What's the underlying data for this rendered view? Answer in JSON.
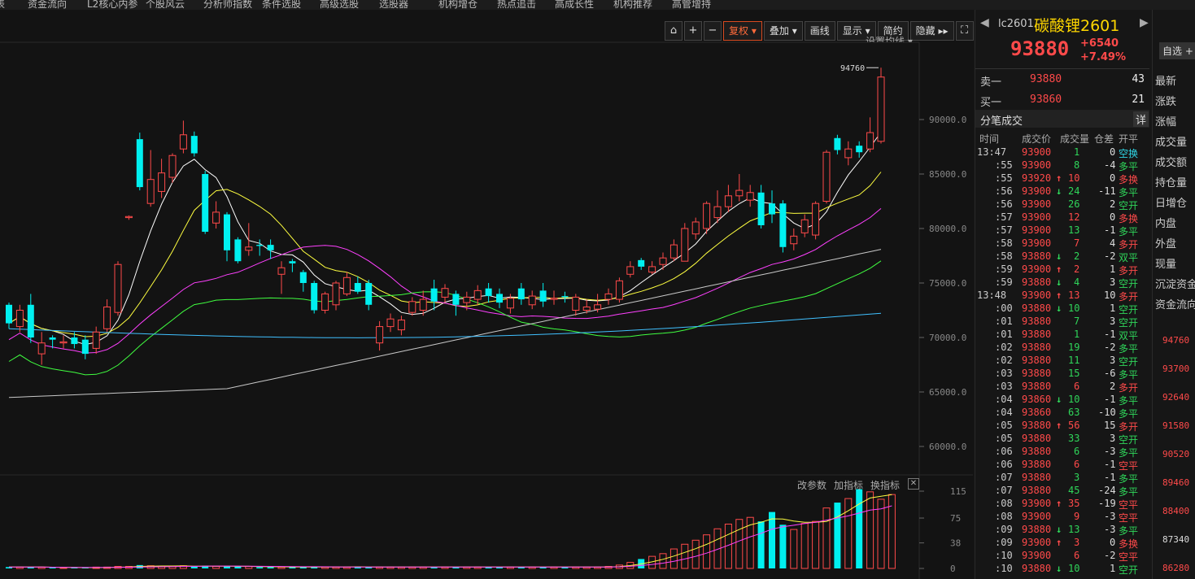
{
  "topnav": [
    "表",
    "资金流向",
    "L2核心内参",
    "个股风云",
    "分析师指数",
    "条件选股",
    "高级选股",
    "选股器",
    "机构增仓",
    "热点追击",
    "高成长性",
    "机构推荐",
    "高管增持"
  ],
  "toolbar": {
    "fuquan": "复权",
    "diejia": "叠加",
    "huaxian": "画线",
    "xianshi": "显示",
    "jianyue": "简约",
    "yincang": "隐藏"
  },
  "settings_ma": "设置均线",
  "max_label": "94760",
  "price_axis": [
    "90000.0",
    "85000.0",
    "80000.0",
    "75000.0",
    "70000.0",
    "65000.0",
    "60000.0"
  ],
  "vol_links": [
    "改参数",
    "加指标",
    "换指标"
  ],
  "vol_axis": [
    "115",
    "75",
    "38",
    "0"
  ],
  "quote": {
    "code": "lc2601",
    "name": "碳酸锂2601",
    "price": "93880",
    "change": "+6540",
    "pct": "+7.49%",
    "fav": "自选"
  },
  "orderbook": [
    {
      "label": "卖一",
      "price": "93880",
      "qty": "43"
    },
    {
      "label": "买一",
      "price": "93860",
      "qty": "21"
    }
  ],
  "ticks_title": "分笔成交",
  "ticks_detail": "详",
  "ticks_header": [
    "时间",
    "成交价",
    "成交量",
    "仓差",
    "开平"
  ],
  "ticks": [
    [
      "13:47",
      "93900",
      "",
      "1",
      "0",
      "空换",
      "red",
      "green",
      "cyan"
    ],
    [
      ":55",
      "93900",
      "",
      "8",
      "-4",
      "多平",
      "red",
      "green",
      "green"
    ],
    [
      ":55",
      "93920",
      "↑",
      "10",
      "0",
      "多换",
      "red",
      "red",
      "red"
    ],
    [
      ":56",
      "93900",
      "↓",
      "24",
      "-11",
      "多平",
      "red",
      "green",
      "green"
    ],
    [
      ":56",
      "93900",
      "",
      "26",
      "2",
      "空开",
      "red",
      "green",
      "green"
    ],
    [
      ":57",
      "93900",
      "",
      "12",
      "0",
      "多换",
      "red",
      "red",
      "red"
    ],
    [
      ":57",
      "93900",
      "",
      "13",
      "-1",
      "多平",
      "red",
      "green",
      "green"
    ],
    [
      ":58",
      "93900",
      "",
      "7",
      "4",
      "多开",
      "red",
      "red",
      "red"
    ],
    [
      ":58",
      "93880",
      "↓",
      "2",
      "-2",
      "双平",
      "red",
      "green",
      "green"
    ],
    [
      ":59",
      "93900",
      "↑",
      "2",
      "1",
      "多开",
      "red",
      "red",
      "red"
    ],
    [
      ":59",
      "93880",
      "↓",
      "4",
      "3",
      "空开",
      "red",
      "green",
      "green"
    ],
    [
      "13:48",
      "93900",
      "↑",
      "13",
      "10",
      "多开",
      "red",
      "red",
      "red"
    ],
    [
      ":00",
      "93880",
      "↓",
      "10",
      "1",
      "空开",
      "red",
      "green",
      "green"
    ],
    [
      ":01",
      "93880",
      "",
      "7",
      "3",
      "空开",
      "red",
      "green",
      "green"
    ],
    [
      ":01",
      "93880",
      "",
      "1",
      "-1",
      "双平",
      "red",
      "green",
      "green"
    ],
    [
      ":02",
      "93880",
      "",
      "19",
      "-2",
      "多平",
      "red",
      "green",
      "green"
    ],
    [
      ":02",
      "93880",
      "",
      "11",
      "3",
      "空开",
      "red",
      "green",
      "green"
    ],
    [
      ":03",
      "93880",
      "",
      "15",
      "-6",
      "多平",
      "red",
      "green",
      "green"
    ],
    [
      ":03",
      "93880",
      "",
      "6",
      "2",
      "多开",
      "red",
      "red",
      "red"
    ],
    [
      ":04",
      "93860",
      "↓",
      "10",
      "-1",
      "多平",
      "red",
      "green",
      "green"
    ],
    [
      ":04",
      "93860",
      "",
      "63",
      "-10",
      "多平",
      "red",
      "green",
      "green"
    ],
    [
      ":05",
      "93880",
      "↑",
      "56",
      "15",
      "多开",
      "red",
      "red",
      "red"
    ],
    [
      ":05",
      "93880",
      "",
      "33",
      "3",
      "空开",
      "red",
      "green",
      "green"
    ],
    [
      ":06",
      "93880",
      "",
      "6",
      "-3",
      "多平",
      "red",
      "green",
      "green"
    ],
    [
      ":06",
      "93880",
      "",
      "6",
      "-1",
      "空平",
      "red",
      "red",
      "red"
    ],
    [
      ":07",
      "93880",
      "",
      "3",
      "-1",
      "多平",
      "red",
      "green",
      "green"
    ],
    [
      ":07",
      "93880",
      "",
      "45",
      "-24",
      "多平",
      "red",
      "green",
      "green"
    ],
    [
      ":08",
      "93900",
      "↑",
      "35",
      "-19",
      "空平",
      "red",
      "red",
      "red"
    ],
    [
      ":08",
      "93900",
      "",
      "9",
      "-3",
      "空平",
      "red",
      "red",
      "red"
    ],
    [
      ":09",
      "93880",
      "↓",
      "13",
      "-3",
      "多平",
      "red",
      "green",
      "green"
    ],
    [
      ":09",
      "93900",
      "↑",
      "3",
      "0",
      "多换",
      "red",
      "red",
      "red"
    ],
    [
      ":10",
      "93900",
      "",
      "6",
      "-2",
      "空平",
      "red",
      "red",
      "red"
    ],
    [
      ":10",
      "93880",
      "↓",
      "10",
      "1",
      "空开",
      "red",
      "green",
      "green"
    ]
  ],
  "right_labels": [
    "最新",
    "涨跌",
    "涨幅",
    "成交量",
    "成交额",
    "持仓量",
    "日增仓",
    "内盘",
    "外盘",
    "现量",
    "沉淀资金",
    "资金流向"
  ],
  "right_prices": [
    "94760",
    "93700",
    "92640",
    "91580",
    "90520",
    "89460",
    "88400",
    "87340",
    "86280"
  ],
  "colors": {
    "up": "#ff4a4a",
    "down": "#00f0f0",
    "ma5": "#ffffff",
    "ma10": "#ffff40",
    "ma20": "#ff40ff",
    "ma30": "#40ff40",
    "ma60": "#c8c8c8",
    "ma120": "#40c0ff"
  },
  "candles": [
    {
      "o": 73000,
      "c": 71300,
      "h": 73200,
      "l": 70800
    },
    {
      "o": 71000,
      "c": 72500,
      "h": 73000,
      "l": 70500
    },
    {
      "o": 73000,
      "c": 70000,
      "h": 74000,
      "l": 69500
    },
    {
      "o": 68500,
      "c": 69500,
      "h": 70500,
      "l": 67500
    },
    {
      "o": 70000,
      "c": 69800,
      "h": 70200,
      "l": 69000
    },
    {
      "o": 69500,
      "c": 69600,
      "h": 70200,
      "l": 69000
    },
    {
      "o": 70000,
      "c": 69400,
      "h": 70500,
      "l": 69000
    },
    {
      "o": 69800,
      "c": 68500,
      "h": 70200,
      "l": 68000
    },
    {
      "o": 69000,
      "c": 70500,
      "h": 71000,
      "l": 68500
    },
    {
      "o": 70800,
      "c": 72800,
      "h": 73500,
      "l": 70500
    },
    {
      "o": 72300,
      "c": 76700,
      "h": 77000,
      "l": 72000
    },
    {
      "o": 81000,
      "c": 81100,
      "h": 81200,
      "l": 80800
    },
    {
      "o": 88200,
      "c": 83800,
      "h": 88800,
      "l": 83500
    },
    {
      "o": 82300,
      "c": 84500,
      "h": 87200,
      "l": 82000
    },
    {
      "o": 83400,
      "c": 85100,
      "h": 86400,
      "l": 82800
    },
    {
      "o": 84700,
      "c": 86700,
      "h": 86900,
      "l": 84200
    },
    {
      "o": 87300,
      "c": 88600,
      "h": 89900,
      "l": 86900
    },
    {
      "o": 88500,
      "c": 86900,
      "h": 88900,
      "l": 86600
    },
    {
      "o": 85000,
      "c": 79700,
      "h": 85300,
      "l": 79500
    },
    {
      "o": 80500,
      "c": 81500,
      "h": 82500,
      "l": 80000
    },
    {
      "o": 81300,
      "c": 78000,
      "h": 81500,
      "l": 77000
    },
    {
      "o": 79000,
      "c": 77000,
      "h": 79200,
      "l": 76800
    },
    {
      "o": 78000,
      "c": 78300,
      "h": 80500,
      "l": 77500
    },
    {
      "o": 78500,
      "c": 78400,
      "h": 79000,
      "l": 77500
    },
    {
      "o": 78500,
      "c": 78000,
      "h": 79000,
      "l": 77200
    },
    {
      "o": 75800,
      "c": 76400,
      "h": 77000,
      "l": 74000
    },
    {
      "o": 77000,
      "c": 76800,
      "h": 77200,
      "l": 76000
    },
    {
      "o": 76000,
      "c": 75000,
      "h": 76200,
      "l": 74200
    },
    {
      "o": 75000,
      "c": 72500,
      "h": 75200,
      "l": 72200
    },
    {
      "o": 72500,
      "c": 74000,
      "h": 74200,
      "l": 72200
    },
    {
      "o": 73000,
      "c": 75000,
      "h": 75200,
      "l": 72500
    },
    {
      "o": 74000,
      "c": 75500,
      "h": 76000,
      "l": 73800
    },
    {
      "o": 75000,
      "c": 74200,
      "h": 75600,
      "l": 74000
    },
    {
      "o": 75000,
      "c": 73000,
      "h": 75300,
      "l": 72500
    },
    {
      "o": 69500,
      "c": 71000,
      "h": 71500,
      "l": 68800
    },
    {
      "o": 71000,
      "c": 71700,
      "h": 72200,
      "l": 70500
    },
    {
      "o": 70700,
      "c": 71600,
      "h": 72000,
      "l": 70200
    },
    {
      "o": 72300,
      "c": 73300,
      "h": 73700,
      "l": 72000
    },
    {
      "o": 72500,
      "c": 73500,
      "h": 74300,
      "l": 72000
    },
    {
      "o": 74500,
      "c": 73300,
      "h": 75300,
      "l": 72500
    },
    {
      "o": 73700,
      "c": 74500,
      "h": 74900,
      "l": 73200
    },
    {
      "o": 74000,
      "c": 73000,
      "h": 74300,
      "l": 72000
    },
    {
      "o": 73200,
      "c": 73700,
      "h": 74200,
      "l": 72500
    },
    {
      "o": 73500,
      "c": 74300,
      "h": 74800,
      "l": 73000
    },
    {
      "o": 74500,
      "c": 73800,
      "h": 75000,
      "l": 73200
    },
    {
      "o": 74000,
      "c": 73200,
      "h": 74500,
      "l": 72700
    },
    {
      "o": 72700,
      "c": 73600,
      "h": 74000,
      "l": 72200
    },
    {
      "o": 74500,
      "c": 73500,
      "h": 75000,
      "l": 73000
    },
    {
      "o": 73000,
      "c": 73800,
      "h": 74300,
      "l": 72600
    },
    {
      "o": 74300,
      "c": 73300,
      "h": 75000,
      "l": 72800
    },
    {
      "o": 73500,
      "c": 73600,
      "h": 74300,
      "l": 73000
    },
    {
      "o": 73800,
      "c": 73700,
      "h": 74200,
      "l": 73200
    },
    {
      "o": 72500,
      "c": 73700,
      "h": 74000,
      "l": 72000
    },
    {
      "o": 72500,
      "c": 72800,
      "h": 73500,
      "l": 72200
    },
    {
      "o": 72600,
      "c": 73000,
      "h": 74000,
      "l": 72300
    },
    {
      "o": 73500,
      "c": 74000,
      "h": 74500,
      "l": 73000
    },
    {
      "o": 73500,
      "c": 75200,
      "h": 75500,
      "l": 73200
    },
    {
      "o": 75800,
      "c": 76500,
      "h": 77000,
      "l": 75500
    },
    {
      "o": 77100,
      "c": 76500,
      "h": 77300,
      "l": 76200
    },
    {
      "o": 76000,
      "c": 76500,
      "h": 77000,
      "l": 75800
    },
    {
      "o": 76700,
      "c": 77300,
      "h": 77800,
      "l": 76200
    },
    {
      "o": 77300,
      "c": 78500,
      "h": 79000,
      "l": 77000
    },
    {
      "o": 77000,
      "c": 80000,
      "h": 80500,
      "l": 77000
    },
    {
      "o": 79500,
      "c": 80600,
      "h": 81000,
      "l": 79000
    },
    {
      "o": 80000,
      "c": 82300,
      "h": 82500,
      "l": 79500
    },
    {
      "o": 81000,
      "c": 82000,
      "h": 83500,
      "l": 80500
    },
    {
      "o": 82000,
      "c": 83000,
      "h": 84000,
      "l": 81500
    },
    {
      "o": 83000,
      "c": 83500,
      "h": 85000,
      "l": 82500
    },
    {
      "o": 82600,
      "c": 83300,
      "h": 84000,
      "l": 82000
    },
    {
      "o": 83300,
      "c": 80300,
      "h": 84000,
      "l": 80000
    },
    {
      "o": 82300,
      "c": 81300,
      "h": 83500,
      "l": 80500
    },
    {
      "o": 82300,
      "c": 78300,
      "h": 82600,
      "l": 77800
    },
    {
      "o": 78600,
      "c": 79300,
      "h": 80000,
      "l": 78000
    },
    {
      "o": 79600,
      "c": 80800,
      "h": 81300,
      "l": 79200
    },
    {
      "o": 79400,
      "c": 82300,
      "h": 82500,
      "l": 79000
    },
    {
      "o": 82500,
      "c": 87000,
      "h": 87200,
      "l": 82300
    },
    {
      "o": 88300,
      "c": 87200,
      "h": 88600,
      "l": 86800
    },
    {
      "o": 86500,
      "c": 87300,
      "h": 88000,
      "l": 85800
    },
    {
      "o": 87600,
      "c": 87000,
      "h": 88000,
      "l": 86500
    },
    {
      "o": 87300,
      "c": 88800,
      "h": 90200,
      "l": 87000
    },
    {
      "o": 88000,
      "c": 93900,
      "h": 94760,
      "l": 87800
    }
  ],
  "volumes": [
    2,
    2,
    2,
    2,
    1,
    1,
    1,
    1,
    2,
    2,
    3,
    3,
    5,
    4,
    3,
    3,
    4,
    3,
    4,
    3,
    3,
    3,
    3,
    2,
    2,
    2,
    2,
    2,
    3,
    2,
    2,
    2,
    3,
    2,
    2,
    2,
    2,
    2,
    2,
    2,
    2,
    2,
    2,
    2,
    2,
    2,
    2,
    2,
    2,
    2,
    2,
    2,
    2,
    2,
    2,
    3,
    5,
    9,
    14,
    18,
    22,
    29,
    36,
    42,
    50,
    59,
    66,
    73,
    76,
    70,
    84,
    65,
    58,
    67,
    70,
    90,
    98,
    104,
    118,
    114,
    103,
    110
  ]
}
